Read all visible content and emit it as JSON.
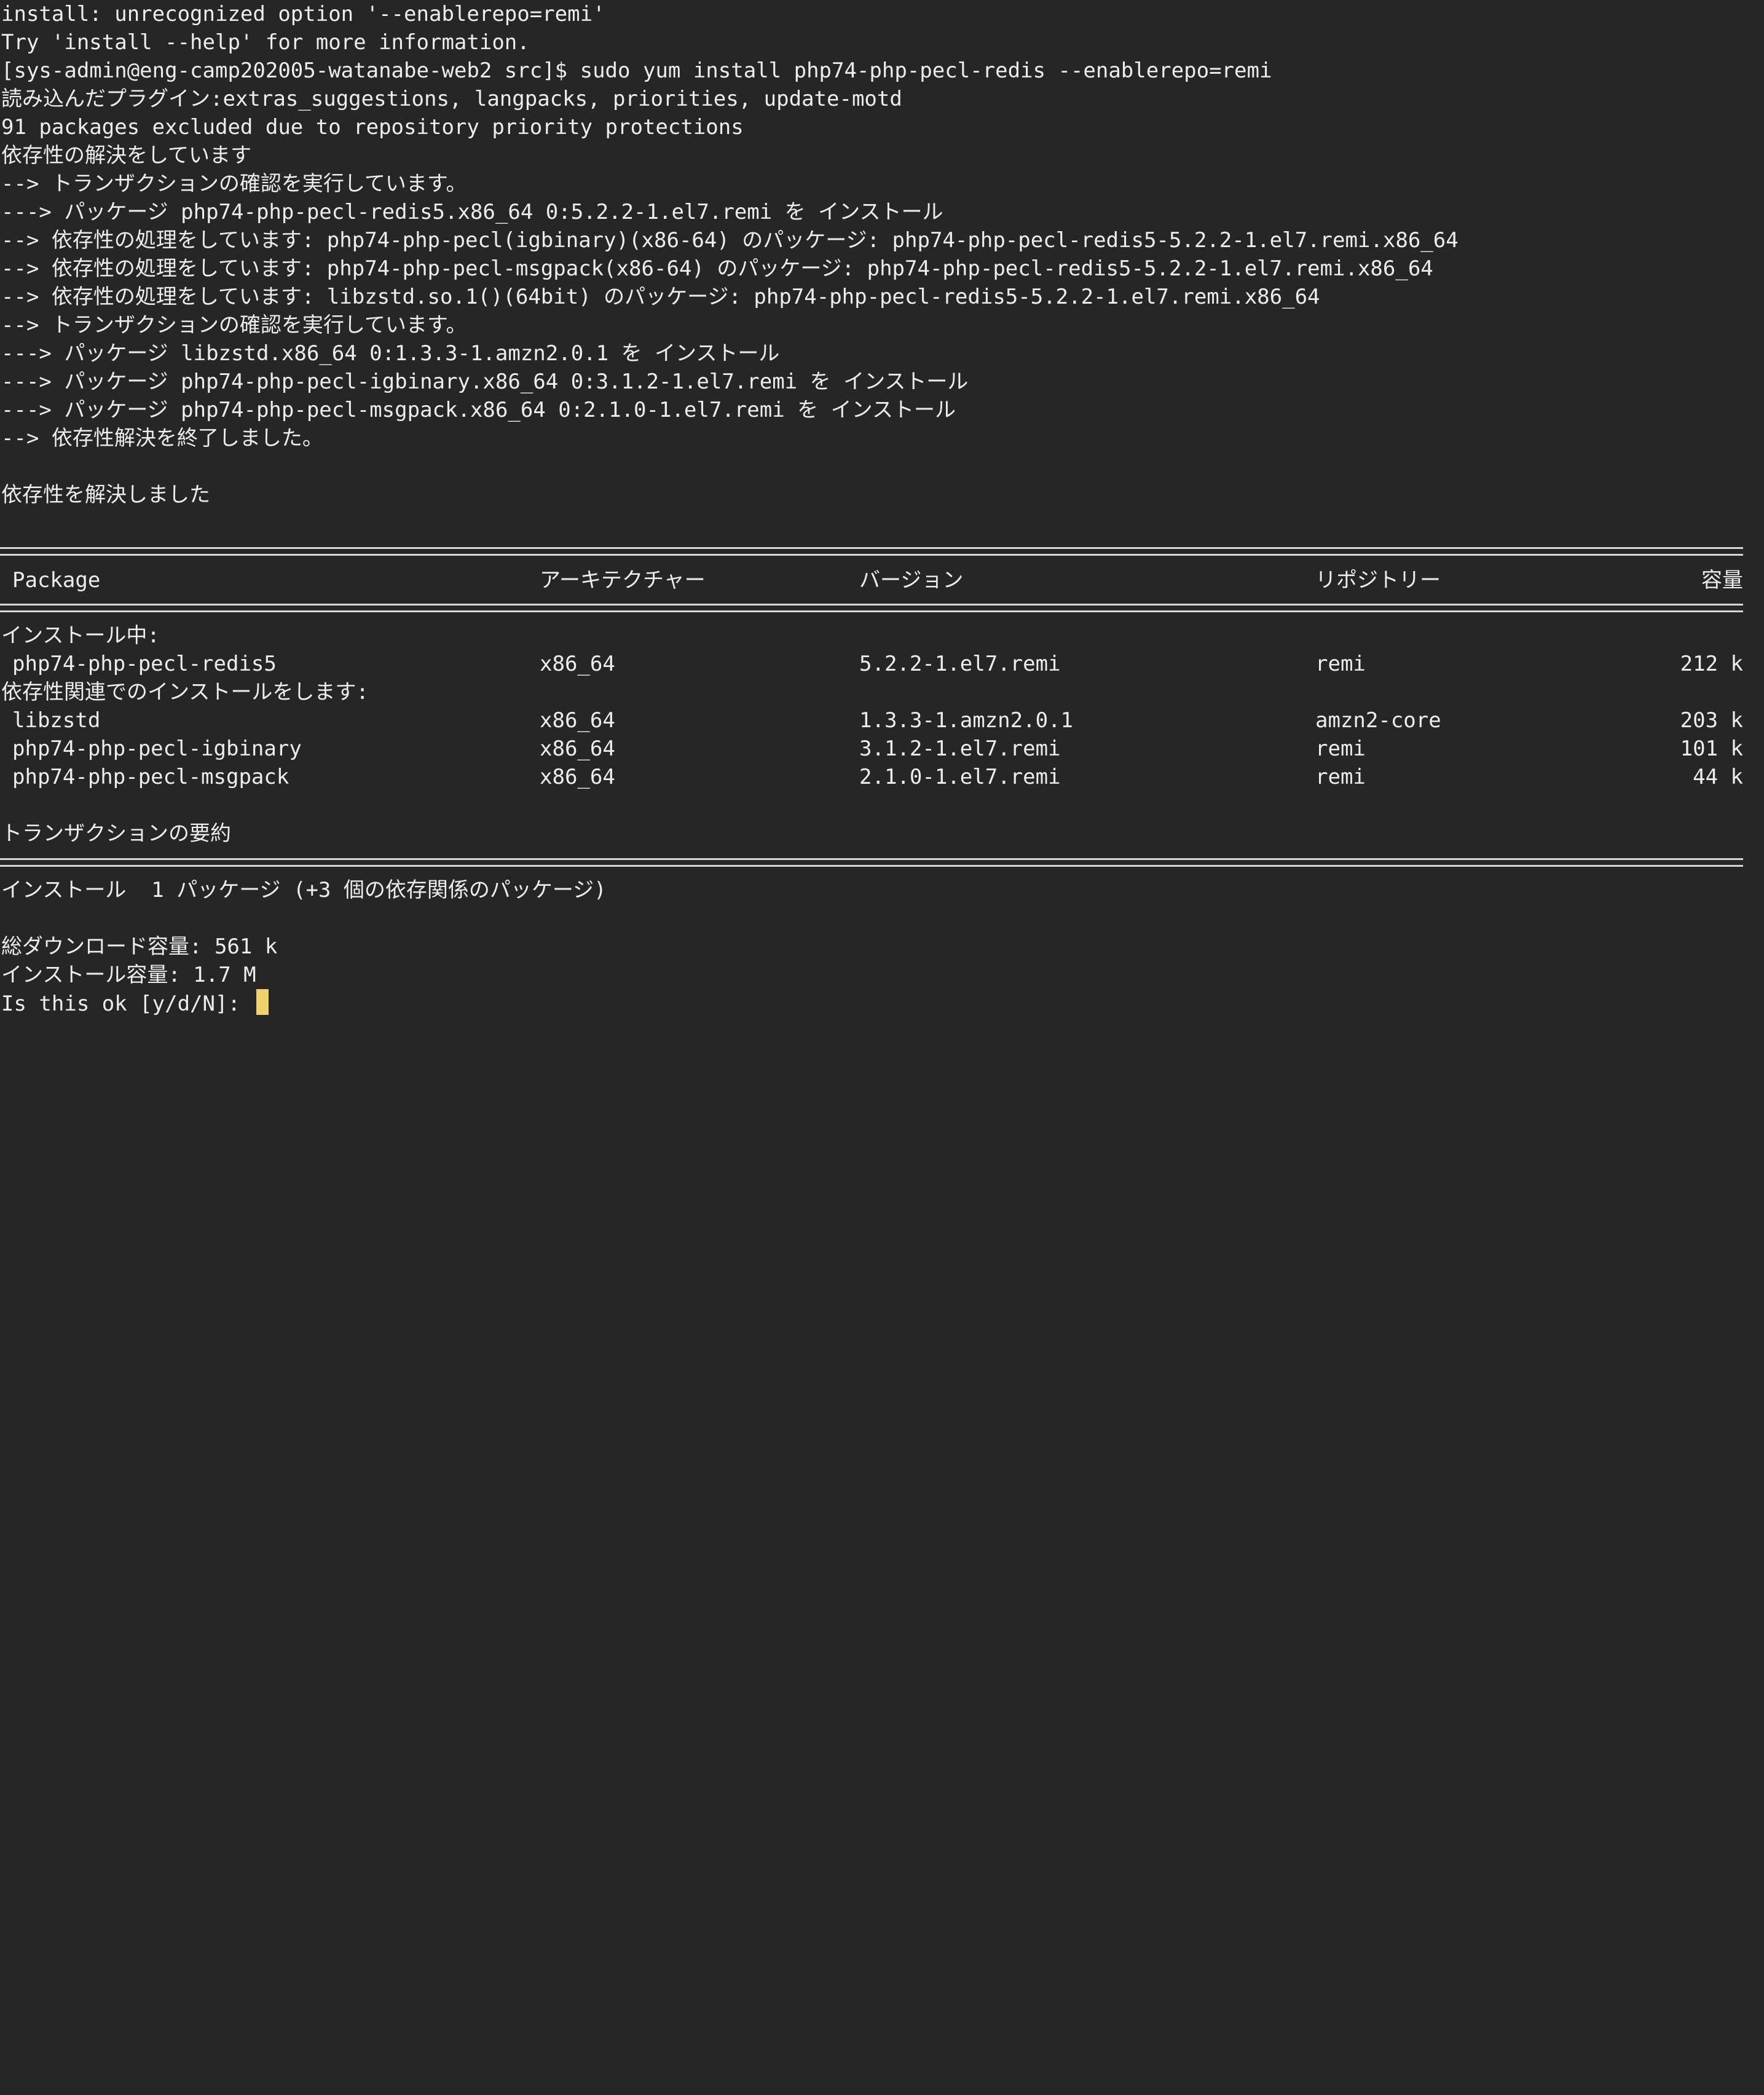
{
  "terminal": {
    "log": [
      "install: unrecognized option '--enablerepo=remi'",
      "Try 'install --help' for more information.",
      "[sys-admin@eng-camp202005-watanabe-web2 src]$ sudo yum install php74-php-pecl-redis --enablerepo=remi",
      "読み込んだプラグイン:extras_suggestions, langpacks, priorities, update-motd",
      "91 packages excluded due to repository priority protections",
      "依存性の解決をしています",
      "--> トランザクションの確認を実行しています。",
      "---> パッケージ php74-php-pecl-redis5.x86_64 0:5.2.2-1.el7.remi を インストール",
      "--> 依存性の処理をしています: php74-php-pecl(igbinary)(x86-64) のパッケージ: php74-php-pecl-redis5-5.2.2-1.el7.remi.x86_64",
      "--> 依存性の処理をしています: php74-php-pecl-msgpack(x86-64) のパッケージ: php74-php-pecl-redis5-5.2.2-1.el7.remi.x86_64",
      "--> 依存性の処理をしています: libzstd.so.1()(64bit) のパッケージ: php74-php-pecl-redis5-5.2.2-1.el7.remi.x86_64",
      "--> トランザクションの確認を実行しています。",
      "---> パッケージ libzstd.x86_64 0:1.3.3-1.amzn2.0.1 を インストール",
      "---> パッケージ php74-php-pecl-igbinary.x86_64 0:3.1.2-1.el7.remi を インストール",
      "---> パッケージ php74-php-pecl-msgpack.x86_64 0:2.1.0-1.el7.remi を インストール",
      "--> 依存性解決を終了しました。",
      "依存性を解決しました"
    ],
    "table": {
      "headers": {
        "package": "Package",
        "arch": "アーキテクチャー",
        "version": "バージョン",
        "repo": "リポジトリー",
        "size": "容量"
      },
      "install_heading": "インストール中:",
      "install_rows": [
        {
          "package": "php74-php-pecl-redis5",
          "arch": "x86_64",
          "version": "5.2.2-1.el7.remi",
          "repo": "remi",
          "size": "212 k"
        }
      ],
      "deps_heading": "依存性関連でのインストールをします:",
      "deps_rows": [
        {
          "package": "libzstd",
          "arch": "x86_64",
          "version": "1.3.3-1.amzn2.0.1",
          "repo": "amzn2-core",
          "size": "203 k"
        },
        {
          "package": "php74-php-pecl-igbinary",
          "arch": "x86_64",
          "version": "3.1.2-1.el7.remi",
          "repo": "remi",
          "size": "101 k"
        },
        {
          "package": "php74-php-pecl-msgpack",
          "arch": "x86_64",
          "version": "2.1.0-1.el7.remi",
          "repo": "remi",
          "size": "44 k"
        }
      ]
    },
    "summary": {
      "heading": "トランザクションの要約",
      "install_line": "インストール  1 パッケージ (+3 個の依存関係のパッケージ)",
      "download_size": "総ダウンロード容量: 561 k",
      "installed_size": "インストール容量: 1.7 M",
      "prompt": "Is this ok [y/d/N]: "
    },
    "colors": {
      "background": "#262626",
      "foreground": "#ededed",
      "cursor": "#f0d16d"
    }
  }
}
